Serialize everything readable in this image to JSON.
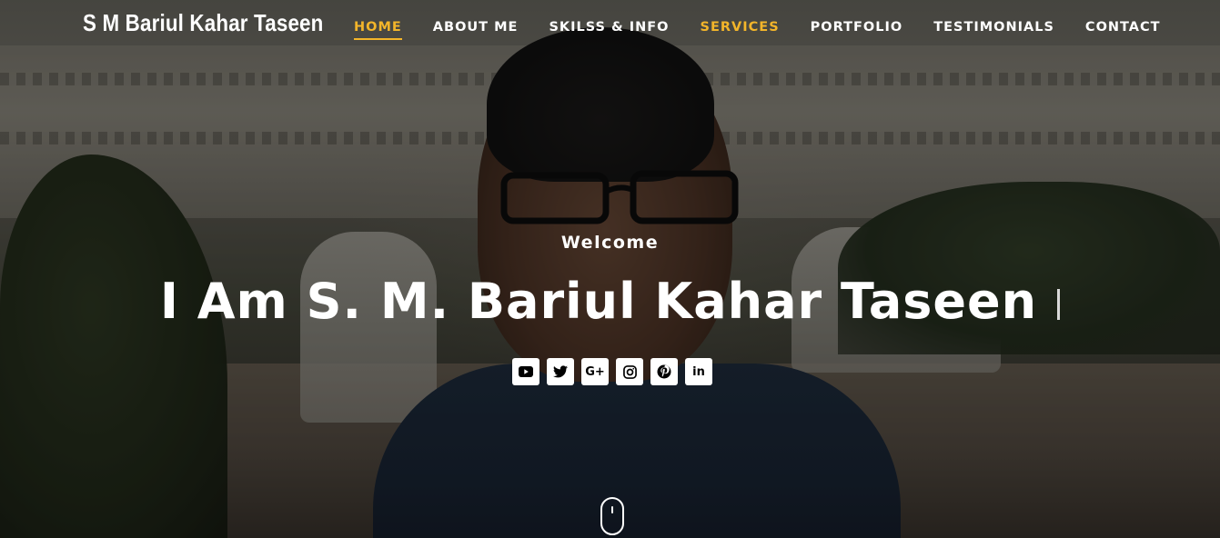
{
  "header": {
    "logo_text": "S M Bariul Kahar Taseen",
    "nav": [
      {
        "label": "HOME"
      },
      {
        "label": "ABOUT ME"
      },
      {
        "label": "SKILSS & INFO"
      },
      {
        "label": "SERVICES"
      },
      {
        "label": "PORTFOLIO"
      },
      {
        "label": "TESTIMONIALS"
      },
      {
        "label": "CONTACT"
      }
    ],
    "active_item": "HOME",
    "accent_color": "#f3b52a"
  },
  "hero": {
    "welcome": "Welcome",
    "headline": "I Am S. M. Bariul Kahar Taseen",
    "socials": [
      {
        "icon": "youtube-icon"
      },
      {
        "icon": "twitter-icon"
      },
      {
        "icon": "google-plus-icon",
        "glyph": "G+"
      },
      {
        "icon": "instagram-icon"
      },
      {
        "icon": "pinterest-icon"
      },
      {
        "icon": "linkedin-icon",
        "glyph": "in"
      }
    ]
  }
}
